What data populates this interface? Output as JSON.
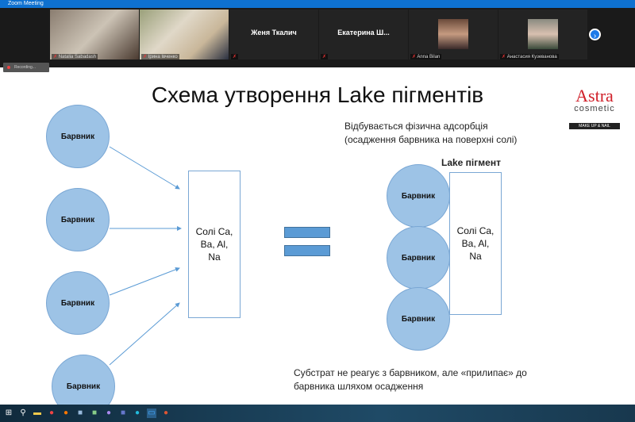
{
  "window": {
    "title": "Zoom Meeting"
  },
  "participants": [
    {
      "name": "Natalia Sabadash",
      "type": "video"
    },
    {
      "name": "Ірина Івченко",
      "type": "video"
    },
    {
      "name": "Женя Ткалич",
      "type": "name"
    },
    {
      "name": "Екатерина  Ш...",
      "type": "name"
    },
    {
      "name": "Anna Bilan",
      "type": "photo"
    },
    {
      "name": "Анастасия Кузеванова",
      "type": "photo"
    }
  ],
  "recording": "Recording...",
  "slide": {
    "title": "Схема утворення Lake пігментів",
    "dye": "Барвник",
    "salts": [
      "Солі Ca,",
      "Ba, Al,",
      "Na"
    ],
    "lake_label": "Lake пігмент",
    "adsorption": [
      "Відбувається фізична адсорбція",
      "(осадження барвника на поверхні солі)"
    ],
    "substrate": [
      "Субстрат не реагує з барвником, але «прилипає» до",
      "барвника шляхом осадження"
    ],
    "logo": {
      "brand": "Astra",
      "sub": "cosmetic",
      "tag": "MAKE UP & NAIL",
      "color": "#d0202a"
    }
  },
  "taskbar": [
    "windows-icon",
    "search-icon",
    "explorer-icon",
    "chrome-icon",
    "firefox-icon",
    "app-icon",
    "photos-icon",
    "viber-icon",
    "teams-icon",
    "edge-icon",
    "zoom-icon",
    "powerpoint-icon"
  ]
}
